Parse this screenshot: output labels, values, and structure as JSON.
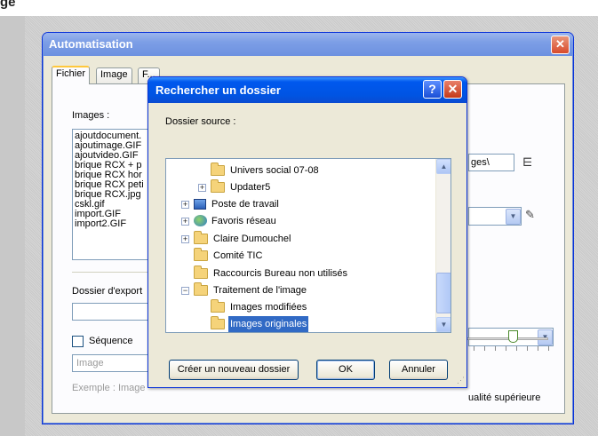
{
  "background": {
    "caption": "ge"
  },
  "main_window": {
    "title": "Automatisation",
    "tabs": [
      "Fichier",
      "Image",
      "F..."
    ],
    "images_label": "Images :",
    "images": [
      "ajoutdocument.",
      "ajoutimage.GIF",
      "ajoutvideo.GIF",
      "brique RCX + p",
      "brique RCX hor",
      "brique RCX peti",
      "brique RCX.jpg",
      "cskl.gif",
      "import.GIF",
      "import2.GIF"
    ],
    "path_value": "ges\\",
    "export_label": "Dossier d'export",
    "sequence_label": "Séquence",
    "image_name_placeholder": "Image",
    "example_text": "Exemple : Image",
    "quality_label": "ualité supérieure"
  },
  "dialog": {
    "title": "Rechercher un dossier",
    "help": "?",
    "close": "✕",
    "source_label": "Dossier source :",
    "tree": [
      {
        "label": "Univers social 07-08",
        "icon": "folder-icon"
      },
      {
        "label": "Updater5",
        "icon": "folder-icon",
        "expander": "+"
      },
      {
        "label": "Poste de travail",
        "icon": "computer-icon",
        "expander": "+"
      },
      {
        "label": "Favoris réseau",
        "icon": "network-icon",
        "expander": "+"
      },
      {
        "label": "Claire Dumouchel",
        "icon": "folder-icon",
        "expander": "+"
      },
      {
        "label": "Comité TIC",
        "icon": "folder-icon"
      },
      {
        "label": "Raccourcis Bureau non utilisés",
        "icon": "folder-icon"
      },
      {
        "label": "Traitement de l'image",
        "icon": "folder-open-icon",
        "expander": "−"
      },
      {
        "label": "Images modifiées",
        "icon": "folder-icon"
      },
      {
        "label": "Images originales",
        "icon": "folder-open-icon",
        "selected": true
      }
    ],
    "new_folder": "Créer un nouveau dossier",
    "ok": "OK",
    "cancel": "Annuler"
  }
}
